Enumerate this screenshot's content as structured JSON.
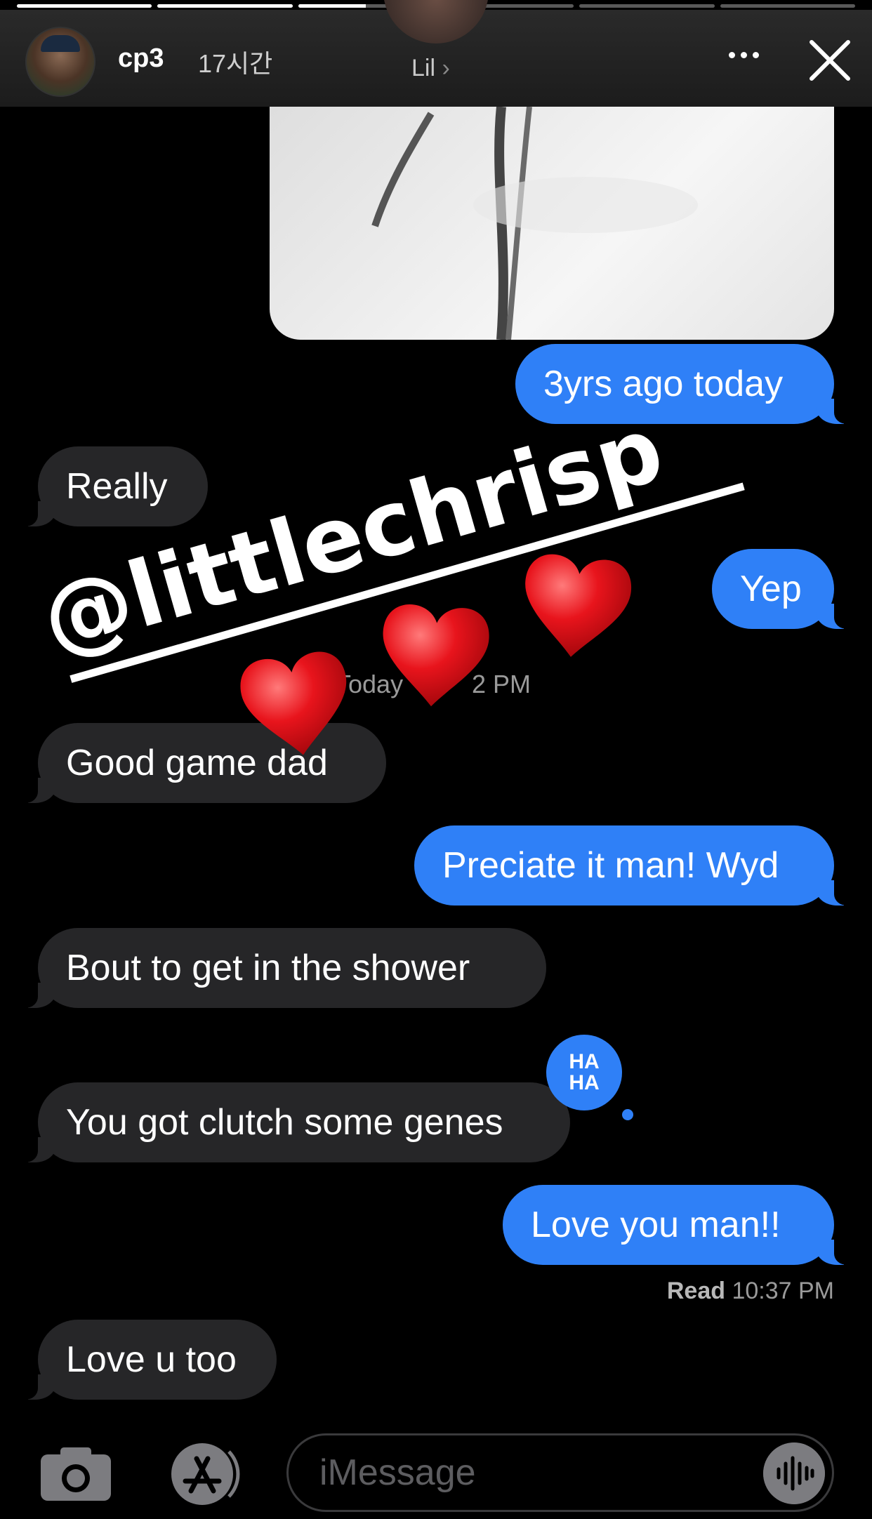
{
  "story": {
    "progress_bars": [
      1,
      1,
      0.5,
      0,
      0,
      0
    ],
    "username": "cp3",
    "time_ago": "17시간",
    "contact_name": "Lil",
    "contact_chevron": "›"
  },
  "conversation": {
    "messages": [
      {
        "side": "sent",
        "text": "3yrs ago today"
      },
      {
        "side": "recv",
        "text": "Really"
      },
      {
        "side": "sent",
        "text": "Yep"
      },
      {
        "side": "recv",
        "text": "Good game dad"
      },
      {
        "side": "sent",
        "text": "Preciate it man! Wyd"
      },
      {
        "side": "recv",
        "text": "Bout to get in the shower"
      },
      {
        "side": "recv",
        "text": "You got clutch some genes"
      },
      {
        "side": "sent",
        "text": "Love you man!!"
      },
      {
        "side": "recv",
        "text": "Love u too"
      }
    ],
    "timestamp_fragments": [
      "Today",
      "2 PM"
    ],
    "read_label": "Read",
    "read_time": "10:37 PM",
    "tapback": {
      "line1": "HA",
      "line2": "HA",
      "icon": "haha-tapback-icon"
    }
  },
  "sticker": {
    "mention": "@littlechrisp",
    "hearts": 3,
    "heart_icon": "red-heart-emoji"
  },
  "composer": {
    "placeholder": "iMessage",
    "icons": [
      "camera-icon",
      "app-store-icon",
      "audio-waveform-icon"
    ]
  },
  "colors": {
    "sent_bubble": "#2f80f7",
    "received_bubble": "#262628",
    "background": "#000000",
    "heart": "#e0141b"
  }
}
